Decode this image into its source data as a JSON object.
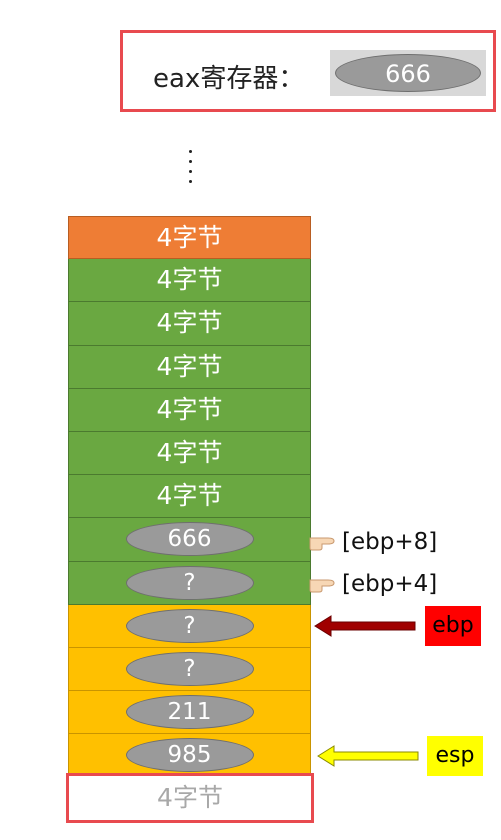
{
  "register": {
    "label": "eax寄存器：",
    "value": "666"
  },
  "ellipsis": "⋮",
  "stack": {
    "cells": [
      {
        "text": "4字节",
        "color": "orange"
      },
      {
        "text": "4字节",
        "color": "green"
      },
      {
        "text": "4字节",
        "color": "green"
      },
      {
        "text": "4字节",
        "color": "green"
      },
      {
        "text": "4字节",
        "color": "green"
      },
      {
        "text": "4字节",
        "color": "green"
      },
      {
        "text": "4字节",
        "color": "green"
      },
      {
        "oval": "666",
        "color": "green"
      },
      {
        "oval": "?",
        "color": "green"
      },
      {
        "oval": "?",
        "color": "yellow"
      },
      {
        "oval": "?",
        "color": "yellow"
      },
      {
        "oval": "211",
        "color": "yellow"
      },
      {
        "oval": "985",
        "color": "yellow"
      }
    ],
    "bottom_label": "4字节"
  },
  "annotations": {
    "ebp_plus_8": "[ebp+8]",
    "ebp_plus_4": "[ebp+4]",
    "ebp": "ebp",
    "esp": "esp"
  },
  "colors": {
    "orange": "#ee7d35",
    "green": "#6aa841",
    "yellow": "#ffc000",
    "highlight_red": "#e84a4f",
    "ebp_tag": "#ff0000",
    "esp_tag": "#ffff00",
    "ebp_arrow": "#a00000",
    "esp_arrow": "#ffff00"
  },
  "icons": {
    "pointer": "hand-pointing-icon"
  }
}
